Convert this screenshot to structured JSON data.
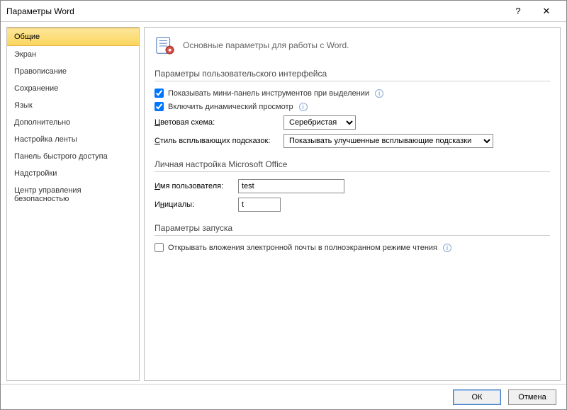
{
  "window": {
    "title": "Параметры Word",
    "help": "?",
    "close": "✕"
  },
  "sidebar": {
    "items": [
      "Общие",
      "Экран",
      "Правописание",
      "Сохранение",
      "Язык",
      "Дополнительно",
      "Настройка ленты",
      "Панель быстрого доступа",
      "Надстройки",
      "Центр управления безопасностью"
    ],
    "selected": 0
  },
  "content": {
    "heading": "Основные параметры для работы с Word.",
    "sections": {
      "ui": {
        "title": "Параметры пользовательского интерфейса",
        "minipanel": "Показывать мини-панель инструментов при выделении",
        "livepreview": "Включить динамический просмотр",
        "colorscheme_label": "Цветовая схема:",
        "colorscheme_value": "Серебристая",
        "tooltip_style_label": "Стиль всплывающих подсказок:",
        "tooltip_style_value": "Показывать улучшенные всплывающие подсказки"
      },
      "personal": {
        "title": "Личная настройка Microsoft Office",
        "username_label": "Имя пользователя:",
        "username_value": "test",
        "initials_label": "Инициалы:",
        "initials_value": "t"
      },
      "startup": {
        "title": "Параметры запуска",
        "fullscreen_read": "Открывать вложения электронной почты в полноэкранном режиме чтения"
      }
    }
  },
  "footer": {
    "ok": "ОК",
    "cancel": "Отмена"
  },
  "checked": {
    "minipanel": true,
    "livepreview": true,
    "fullscreen_read": false
  }
}
